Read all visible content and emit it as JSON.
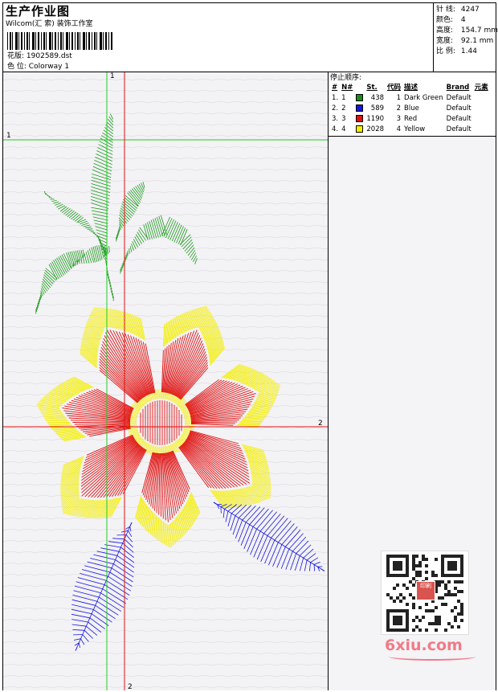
{
  "header": {
    "title": "生产作业图",
    "studio": "Wilcom(汇 索) 装饰工作室",
    "file_label": "花版:",
    "file_name": "1902589.dst",
    "colorway_label": "色 位:",
    "colorway": "Colorway 1"
  },
  "stats": [
    {
      "label": "针 线:",
      "value": "4247"
    },
    {
      "label": "颜色:",
      "value": "4"
    },
    {
      "label": "高度:",
      "value": "154.7 mm"
    },
    {
      "label": "宽度:",
      "value": "92.1 mm"
    },
    {
      "label": "比 例:",
      "value": "1.44"
    }
  ],
  "stop_sequence": {
    "title": "停止顺序:",
    "columns": [
      "#",
      "N#",
      "St.",
      "代码",
      "描述",
      "Brand",
      "元素"
    ],
    "rows": [
      {
        "idx": "1.",
        "n": "1",
        "swatch": "#1a8a1a",
        "st": "438",
        "code": "1",
        "desc": "Dark Green",
        "brand": "Default"
      },
      {
        "idx": "2.",
        "n": "2",
        "swatch": "#1515e0",
        "st": "589",
        "code": "2",
        "desc": "Blue",
        "brand": "Default"
      },
      {
        "idx": "3.",
        "n": "3",
        "swatch": "#e01010",
        "st": "1190",
        "code": "3",
        "desc": "Red",
        "brand": "Default"
      },
      {
        "idx": "4.",
        "n": "4",
        "swatch": "#f5f000",
        "st": "2028",
        "code": "4",
        "desc": "Yellow",
        "brand": "Default"
      }
    ]
  },
  "guides": {
    "green_v_label": "1",
    "green_h_label": "1",
    "red_h_label": "2",
    "red_v_label": "2"
  },
  "colors": {
    "green_guide": "#22cc22",
    "red_guide": "#e01010",
    "thread_green": "#1a9a1a",
    "thread_blue": "#1515e0",
    "thread_red": "#e01010",
    "thread_yellow": "#f5f000"
  },
  "watermark": {
    "site": "6xiu.com",
    "seal_text": "印刷"
  }
}
